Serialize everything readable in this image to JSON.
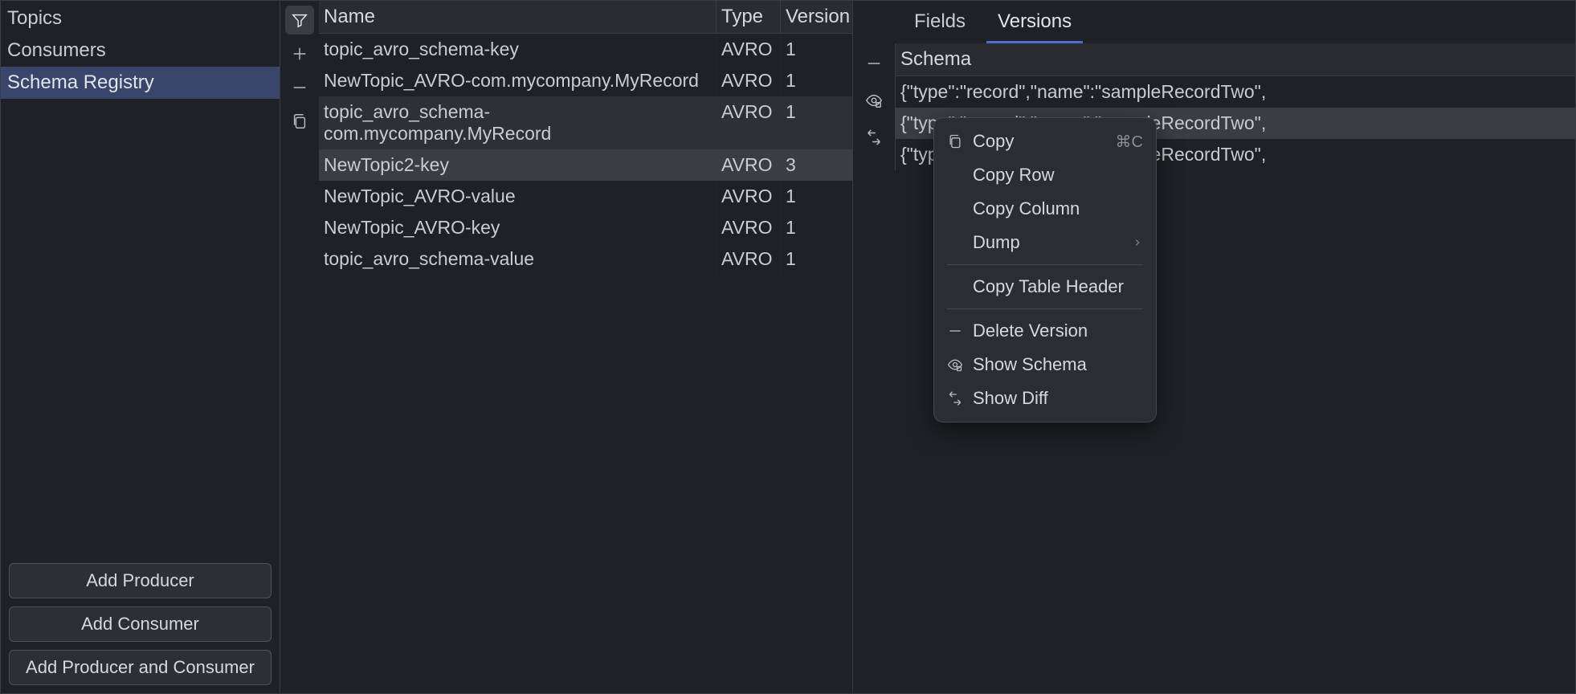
{
  "sidebar": {
    "items": [
      {
        "label": "Topics"
      },
      {
        "label": "Consumers"
      },
      {
        "label": "Schema Registry"
      }
    ],
    "buttons": {
      "add_producer": "Add Producer",
      "add_consumer": "Add Consumer",
      "add_both": "Add Producer and Consumer"
    }
  },
  "table": {
    "columns": {
      "name": "Name",
      "type": "Type",
      "version": "Version"
    },
    "rows": [
      {
        "name": "topic_avro_schema-key",
        "type": "AVRO",
        "version": "1"
      },
      {
        "name": "NewTopic_AVRO-com.mycompany.MyRecord",
        "type": "AVRO",
        "version": "1"
      },
      {
        "name": "topic_avro_schema-com.mycompany.MyRecord",
        "type": "AVRO",
        "version": "1"
      },
      {
        "name": "NewTopic2-key",
        "type": "AVRO",
        "version": "3"
      },
      {
        "name": "NewTopic_AVRO-value",
        "type": "AVRO",
        "version": "1"
      },
      {
        "name": "NewTopic_AVRO-key",
        "type": "AVRO",
        "version": "1"
      },
      {
        "name": "topic_avro_schema-value",
        "type": "AVRO",
        "version": "1"
      }
    ]
  },
  "right": {
    "tabs": {
      "fields": "Fields",
      "versions": "Versions"
    },
    "schema_header": "Schema",
    "schema_rows": [
      "{\"type\":\"record\",\"name\":\"sampleRecordTwo\",",
      "{\"type\":\"record\",\"name\":\"sampleRecordTwo\",",
      "{\"type\":\"record\",\"name\":\"sampleRecordTwo\","
    ]
  },
  "context_menu": {
    "copy": "Copy",
    "copy_shortcut": "⌘C",
    "copy_row": "Copy Row",
    "copy_column": "Copy Column",
    "dump": "Dump",
    "copy_table_header": "Copy Table Header",
    "delete_version": "Delete Version",
    "show_schema": "Show Schema",
    "show_diff": "Show Diff"
  }
}
